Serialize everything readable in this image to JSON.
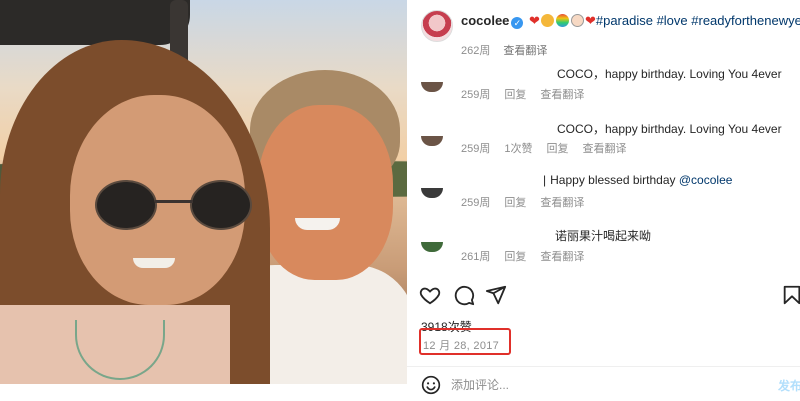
{
  "post": {
    "username": "cocolee",
    "caption_tags": "#paradise #love #readyforthenewyear",
    "age": "262周",
    "translate": "查看翻译"
  },
  "comments": [
    {
      "text": "COCO，happy birthday. Loving You 4ever",
      "mention": "",
      "age": "259周",
      "likes": "",
      "reply": "回复",
      "translate": "查看翻译"
    },
    {
      "text": "COCO，happy birthday. Loving You 4ever",
      "mention": "",
      "age": "259周",
      "likes": "1次赞",
      "reply": "回复",
      "translate": "查看翻译"
    },
    {
      "text": "Happy blessed birthday ",
      "mention": "@cocolee",
      "age": "259周",
      "likes": "",
      "reply": "回复",
      "translate": "查看翻译"
    },
    {
      "text": "诺丽果汁喝起来呦",
      "mention": "",
      "age": "261周",
      "likes": "",
      "reply": "回复",
      "translate": "查看翻译"
    }
  ],
  "actions": {
    "like_icon": "heart-icon",
    "comment_icon": "comment-icon",
    "share_icon": "send-icon",
    "save_icon": "bookmark-icon"
  },
  "likes_count": "3918次赞",
  "date": "12 月 28, 2017",
  "add_comment": {
    "placeholder": "添加评论...",
    "post_label": "发布"
  },
  "colors": {
    "highlight_border": "#e0302a",
    "link": "#00376b",
    "post_button": "#b2dffc"
  }
}
